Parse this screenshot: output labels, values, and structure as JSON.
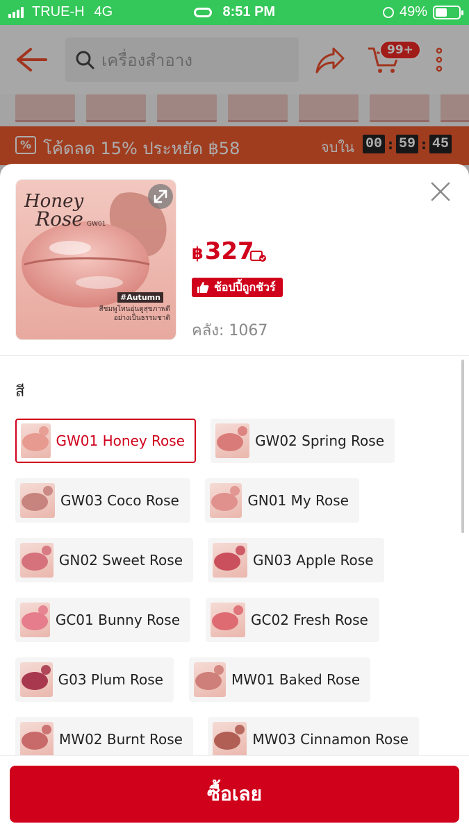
{
  "status_bar": {
    "carrier": "TRUE-H",
    "network": "4G",
    "time": "8:51 PM",
    "battery": "49%",
    "battery_level": 0.49
  },
  "header": {
    "search_placeholder": "เครื่องสำอาง",
    "cart_count": "99+"
  },
  "promo": {
    "icon": "%",
    "text": "โค้ดลด 15% ประหยัด ฿58",
    "ends_in_label": "จบใน",
    "timer": [
      "00",
      "59",
      "45"
    ]
  },
  "product": {
    "image": {
      "title_line1": "Honey",
      "title_line2": "Rose",
      "code": "GW01",
      "tag": "#Autumn",
      "caption_line1": "สีชมพูโทนอุ่นดูสุขภาพดี",
      "caption_line2": "อย่างเป็นธรรมชาติ"
    },
    "currency": "฿",
    "price": "327",
    "guarantee_badge": "ช้อปปี้ถูกชัวร์",
    "stock": "คลัง: 1067"
  },
  "options": {
    "title": "สี",
    "items": [
      {
        "label": "GW01 Honey Rose",
        "selected": true,
        "color": "#e79a90"
      },
      {
        "label": "GW02 Spring Rose",
        "selected": false,
        "color": "#d97c79"
      },
      {
        "label": "GW03 Coco Rose",
        "selected": false,
        "color": "#c7837d"
      },
      {
        "label": "GN01 My Rose",
        "selected": false,
        "color": "#e0918d"
      },
      {
        "label": "GN02 Sweet Rose",
        "selected": false,
        "color": "#d5727c"
      },
      {
        "label": "GN03 Apple Rose",
        "selected": false,
        "color": "#c9505c"
      },
      {
        "label": "GC01 Bunny Rose",
        "selected": false,
        "color": "#e57d8d"
      },
      {
        "label": "GC02 Fresh Rose",
        "selected": false,
        "color": "#de6b72"
      },
      {
        "label": "G03 Plum Rose",
        "selected": false,
        "color": "#a8384e"
      },
      {
        "label": "MW01 Baked Rose",
        "selected": false,
        "color": "#cf7f7a"
      },
      {
        "label": "MW02 Burnt Rose",
        "selected": false,
        "color": "#c96a6a"
      },
      {
        "label": "MW03 Cinnamon Rose",
        "selected": false,
        "color": "#b15f55"
      }
    ]
  },
  "buy_button": "ซื้อเลย",
  "colors": {
    "status_green": "#34c759",
    "brand_red": "#d0011b",
    "promo_orange": "#ee5a2f"
  }
}
